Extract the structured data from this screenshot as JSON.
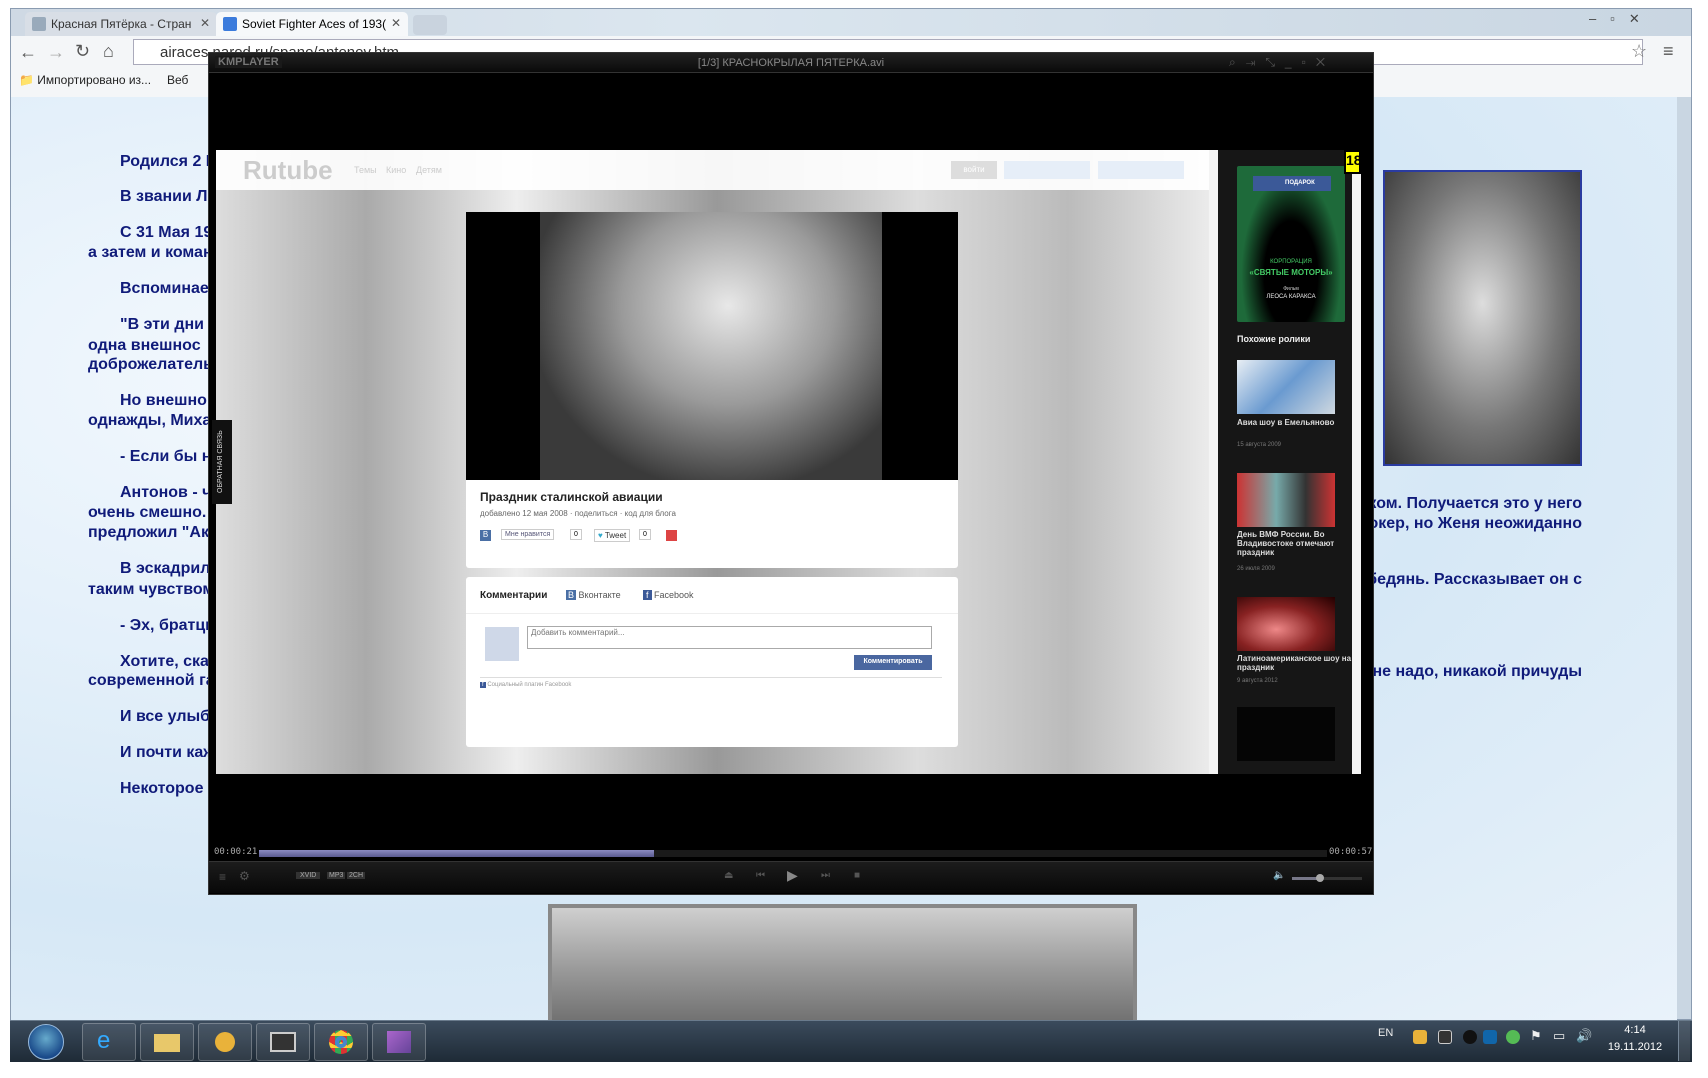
{
  "browser": {
    "tabs": [
      {
        "label": "Красная Пятёрка - Стран",
        "active": false
      },
      {
        "label": "Soviet Fighter Aces of 193(",
        "active": true
      }
    ],
    "url": "airaces.narod.ru/spano/antonov.htm",
    "bookmarks": [
      "Импортировано из...",
      "Веб"
    ]
  },
  "page": {
    "left_lines": [
      "Родился 2 I",
      "В звании Л",
      "С 31 Мая 19",
      "а затем и коман",
      "Вспоминае",
      "\"В эти дни",
      "одна   внешнос",
      "доброжелатель",
      "Но внешно",
      "однажды, Миха",
      "- Если бы н",
      "Антонов - ч",
      "очень смешно.",
      "предложил \"Ак",
      "В эскадрил",
      "таким чувством",
      "- Эх, братць",
      "Хотите, ска",
      "современной га",
      "И все улыб",
      "И почти каж",
      "Некоторое"
    ],
    "right_lines": [
      "ком. Получается это у него",
      "окер, но Женя неожиданно",
      "бедянь. Рассказывает он с",
      "не надо, никакой причуды"
    ]
  },
  "player": {
    "brand": "KMPLAYER",
    "title": "[1/3] КРАСНОКРЫЛАЯ ПЯТЕРКА.avi",
    "time_elapsed": "00:00:21",
    "time_total": "00:00:57",
    "progress": 0.37,
    "volume": 0.4,
    "codecs": [
      "XVID",
      "MP3",
      "2CH"
    ],
    "feedback": "ОБРАТНАЯ СВЯЗЬ",
    "rutube": {
      "logo": "Rutube",
      "nav": [
        "Темы",
        "Кино",
        "Детям"
      ],
      "login": "войти",
      "video_title": "Праздник сталинской авиации",
      "meta": [
        "добавлено 12 мая 2008",
        "поделиться",
        "код для блога"
      ],
      "like_label": "Мне нравится",
      "like_count": "0",
      "tweet_label": "Tweet",
      "tweet_count": "0",
      "comments": {
        "heading": "Комментарии",
        "tabs": [
          "Вконтакте",
          "Facebook"
        ],
        "placeholder": "Добавить комментарий...",
        "submit": "Комментировать",
        "plugin": "Социальный плагин Facebook"
      },
      "ad": {
        "badge": "ПОДАРОК",
        "line1": "КОРПОРАЦИЯ",
        "line2": "«СВЯТЫЕ МОТОРЫ»",
        "line3": "Фильм",
        "line4": "ЛЕОСА КАРАКСА"
      },
      "related_heading": "Похожие ролики",
      "related": [
        {
          "title": "Авиа шоу в Емельяново",
          "date": "15 августа 2009"
        },
        {
          "title": "День ВМФ России. Во Владивостоке отмечают праздник",
          "date": "26 июля 2009"
        },
        {
          "title": "Латиноамериканское шоу на праздник",
          "date": "9 августа 2012"
        }
      ]
    },
    "overlay_badge": "18"
  },
  "taskbar": {
    "lang": "EN",
    "time": "4:14",
    "date": "19.11.2012"
  }
}
